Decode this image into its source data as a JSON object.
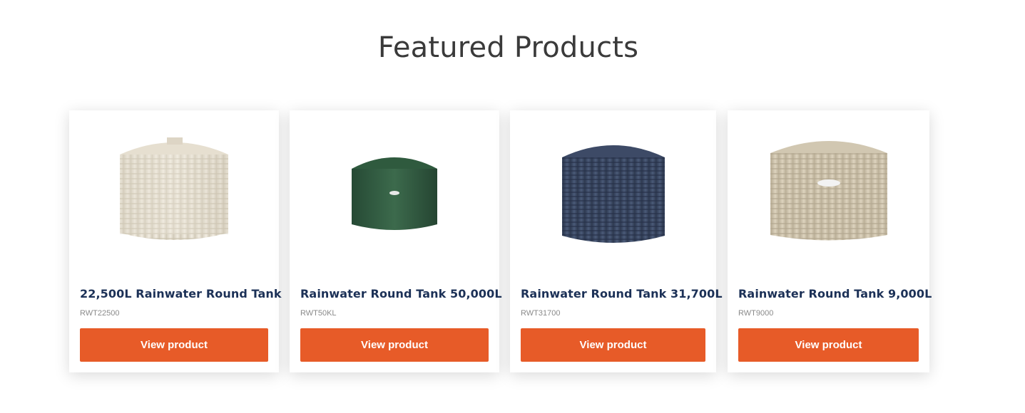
{
  "section": {
    "title": "Featured Products"
  },
  "colors": {
    "accent": "#e75b28",
    "title_text": "#1c3157"
  },
  "products": [
    {
      "name": "22,500L Rainwater Round Tank",
      "sku": "RWT22500",
      "button_label": "View product",
      "image_icon": "cream-round-water-tank"
    },
    {
      "name": "Rainwater Round Tank 50,000L",
      "sku": "RWT50KL",
      "button_label": "View product",
      "image_icon": "green-round-water-tank"
    },
    {
      "name": "Rainwater Round Tank 31,700L",
      "sku": "RWT31700",
      "button_label": "View product",
      "image_icon": "navy-round-water-tank"
    },
    {
      "name": "Rainwater Round Tank 9,000L",
      "sku": "RWT9000",
      "button_label": "View product",
      "image_icon": "beige-round-water-tank"
    }
  ]
}
